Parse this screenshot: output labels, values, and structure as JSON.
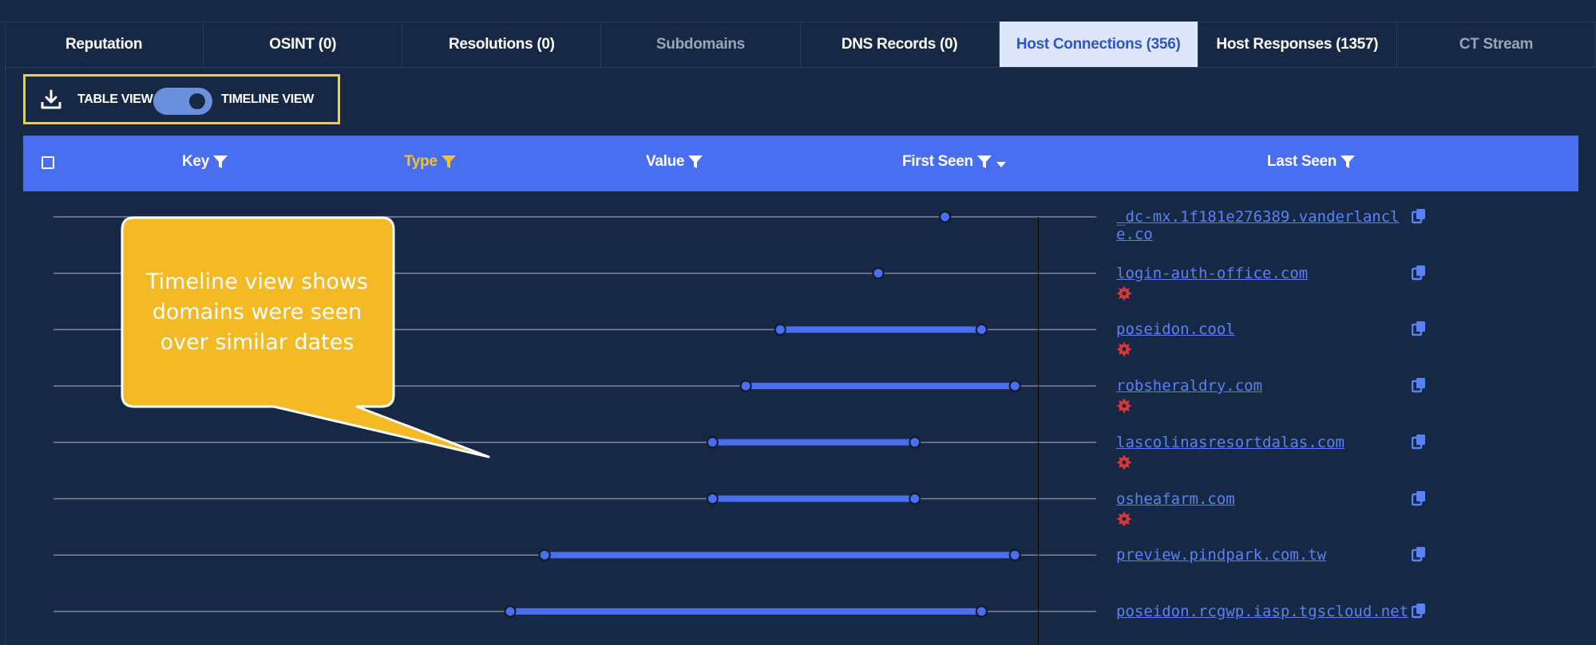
{
  "tabs": [
    {
      "label": "Reputation",
      "state": "normal"
    },
    {
      "label": "OSINT (0)",
      "state": "normal"
    },
    {
      "label": "Resolutions (0)",
      "state": "normal"
    },
    {
      "label": "Subdomains",
      "state": "dim"
    },
    {
      "label": "DNS Records (0)",
      "state": "normal"
    },
    {
      "label": "Host Connections (356)",
      "state": "active"
    },
    {
      "label": "Host Responses (1357)",
      "state": "normal"
    },
    {
      "label": "CT Stream",
      "state": "dim"
    }
  ],
  "toolbar": {
    "download_icon": "download-icon",
    "table_view_label": "TABLE VIEW",
    "timeline_view_label": "TIMELINE VIEW",
    "toggle_on": true
  },
  "table": {
    "columns": [
      {
        "label": "Key",
        "highlighted": false
      },
      {
        "label": "Type",
        "highlighted": true
      },
      {
        "label": "Value",
        "highlighted": false
      },
      {
        "label": "First Seen",
        "highlighted": false,
        "sorted": "desc"
      },
      {
        "label": "Last Seen",
        "highlighted": false
      }
    ],
    "rows": [
      {
        "domain": "_dc-mx.1f181e276389.vanderlancle.co",
        "malicious": false,
        "timeline": [
          0.855,
          0.855
        ]
      },
      {
        "domain": "login-auth-office.com",
        "malicious": true,
        "timeline": [
          0.791,
          0.791
        ]
      },
      {
        "domain": "poseidon.cool",
        "malicious": true,
        "timeline": [
          0.697,
          0.89
        ]
      },
      {
        "domain": "robsheraldry.com",
        "malicious": true,
        "timeline": [
          0.664,
          0.922
        ]
      },
      {
        "domain": "lascolinasresortdalas.com",
        "malicious": true,
        "timeline": [
          0.632,
          0.826
        ]
      },
      {
        "domain": "osheafarm.com",
        "malicious": true,
        "timeline": [
          0.632,
          0.826
        ]
      },
      {
        "domain": "preview.pindpark.com.tw",
        "malicious": false,
        "timeline": [
          0.471,
          0.922
        ]
      },
      {
        "domain": "poseidon.rcgwp.iasp.tgscloud.net",
        "malicious": false,
        "timeline": [
          0.438,
          0.89
        ]
      }
    ]
  },
  "callout": {
    "lines": [
      "Timeline view shows",
      "domains  were seen",
      "over similar dates"
    ]
  },
  "colors": {
    "background": "#172844",
    "accent": "#4a6ef0",
    "highlight": "#f2d31f",
    "callout": "#f3ba25",
    "malicious": "#d9363a",
    "link": "#5a82f5"
  }
}
